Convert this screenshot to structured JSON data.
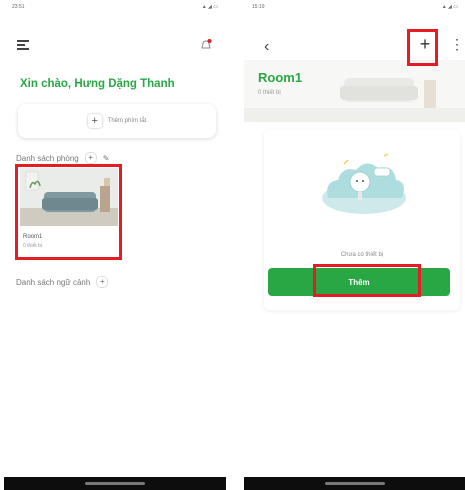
{
  "left_screen": {
    "status_time": "23:51",
    "greeting": "Xin chào, Hưng Dặng Thanh",
    "add_favorite_label": "Thêm phím tắt",
    "rooms_section_title": "Danh sách phòng",
    "room": {
      "name": "Room1",
      "device_count": "0 thiết bị"
    },
    "scenes_section_title": "Danh sách ngữ cảnh"
  },
  "right_screen": {
    "status_time": "15:19",
    "room_title": "Room1",
    "room_subtitle": "0 thiết bị",
    "add_icon": "+",
    "no_device_text": "Chưa có thiết bị",
    "add_button_label": "Thêm"
  },
  "colors": {
    "accent": "#27a844",
    "highlight": "#e41c23"
  },
  "icons": [
    "hamburger-icon",
    "bell-icon",
    "plus-icon",
    "pencil-icon",
    "back-icon",
    "more-icon"
  ]
}
